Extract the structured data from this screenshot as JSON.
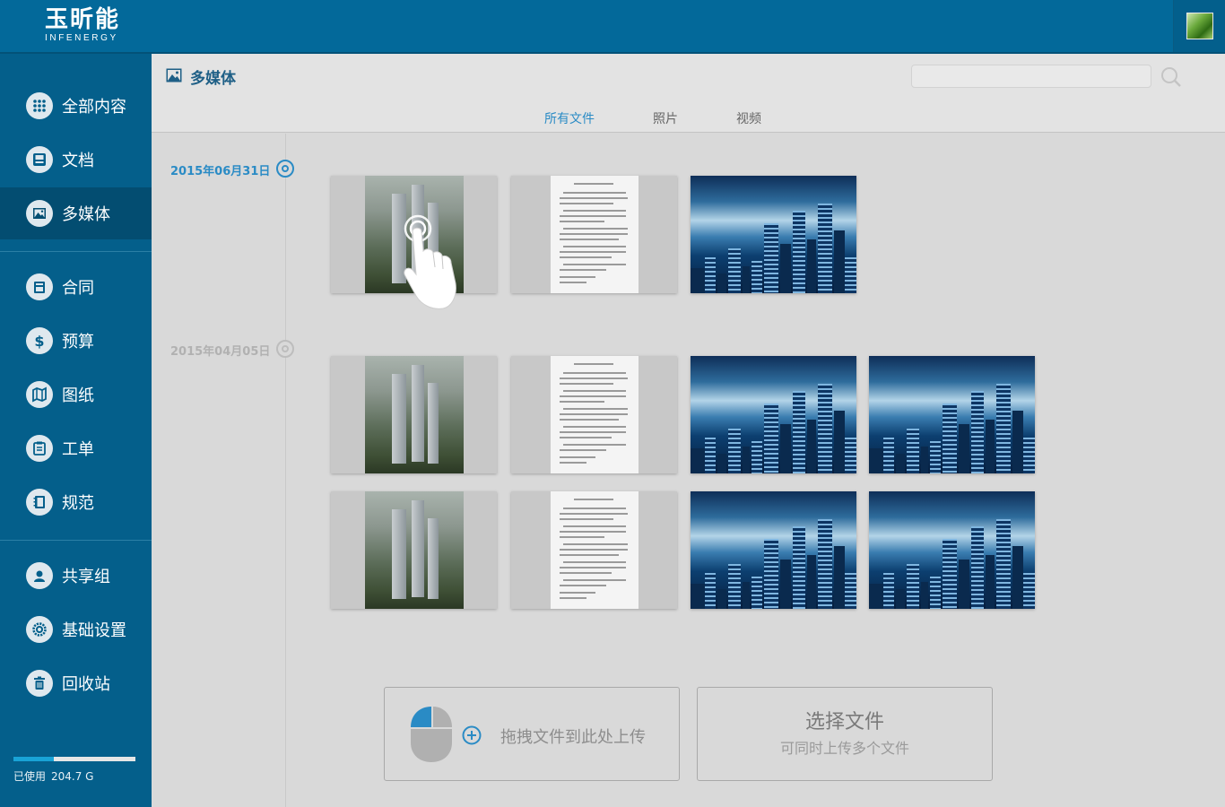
{
  "brand": {
    "name": "玉昕能",
    "sub": "INFENERGY"
  },
  "sidebar": {
    "items": [
      {
        "label": "全部内容",
        "icon": "grid-dots-icon"
      },
      {
        "label": "文档",
        "icon": "inbox-tray-icon"
      },
      {
        "label": "多媒体",
        "icon": "image-icon",
        "active": true
      },
      {
        "label": "合同",
        "icon": "printer-icon"
      },
      {
        "label": "预算",
        "icon": "dollar-icon"
      },
      {
        "label": "图纸",
        "icon": "map-icon"
      },
      {
        "label": "工单",
        "icon": "clipboard-icon"
      },
      {
        "label": "规范",
        "icon": "book-icon"
      },
      {
        "label": "共享组",
        "icon": "user-group-icon"
      },
      {
        "label": "基础设置",
        "icon": "gear-icon"
      },
      {
        "label": "回收站",
        "icon": "trash-icon"
      }
    ],
    "usage": {
      "label": "已使用",
      "value": "204.7 G",
      "fraction": 0.33
    }
  },
  "header": {
    "title": "多媒体",
    "search_placeholder": "",
    "tabs": [
      {
        "label": "所有文件",
        "active": true
      },
      {
        "label": "照片"
      },
      {
        "label": "视频"
      }
    ]
  },
  "timeline": [
    {
      "date": "2015年06月31日",
      "active": true
    },
    {
      "date": "2015年04月05日",
      "active": false
    }
  ],
  "upload": {
    "drag_text": "拖拽文件到此处上传",
    "select_title": "选择文件",
    "select_sub": "可同时上传多个文件"
  },
  "colors": {
    "topbar": "#03699a",
    "sidebar": "#045f8b",
    "sidebar_active": "#034d71",
    "accent": "#2a8bc5"
  }
}
